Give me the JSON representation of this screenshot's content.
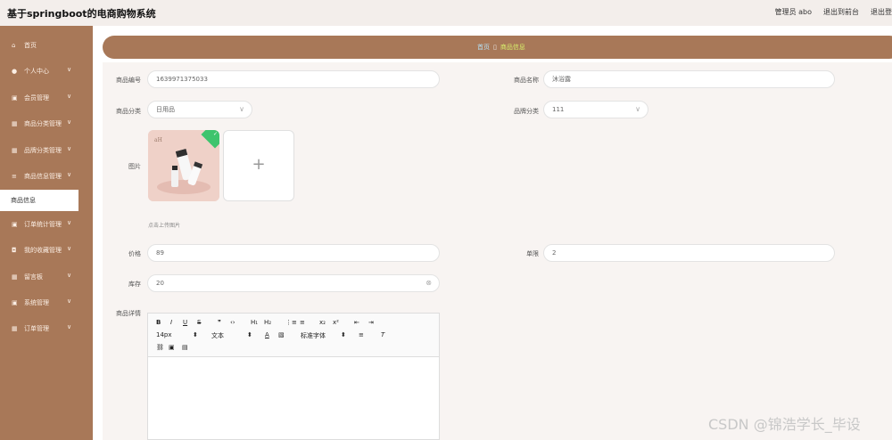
{
  "app": {
    "title": "基于springboot的电商购物系统"
  },
  "header": {
    "user": "管理员 abo",
    "back_front": "退出到前台",
    "logout": "退出登"
  },
  "sidebar": {
    "items": [
      {
        "label": "首页",
        "icon": "home-icon",
        "has_chevron": false
      },
      {
        "label": "个人中心",
        "icon": "person-icon",
        "has_chevron": true
      },
      {
        "label": "会员管理",
        "icon": "briefcase-icon",
        "has_chevron": true
      },
      {
        "label": "商品分类管理",
        "icon": "grid-icon",
        "has_chevron": true
      },
      {
        "label": "品牌分类管理",
        "icon": "grid-icon",
        "has_chevron": true
      },
      {
        "label": "商品信息管理",
        "icon": "list-icon",
        "has_chevron": true
      },
      {
        "label": "商品信息",
        "icon": "",
        "has_chevron": false,
        "active": true
      },
      {
        "label": "订单统计管理",
        "icon": "briefcase-icon",
        "has_chevron": true
      },
      {
        "label": "我的收藏管理",
        "icon": "database-icon",
        "has_chevron": true
      },
      {
        "label": "留言板",
        "icon": "grid-icon",
        "has_chevron": true
      },
      {
        "label": "系统管理",
        "icon": "briefcase-icon",
        "has_chevron": true
      },
      {
        "label": "订单管理",
        "icon": "grid-icon",
        "has_chevron": true
      }
    ]
  },
  "breadcrumb": {
    "home": "首页",
    "sep": "▯",
    "current": "商品信息"
  },
  "form": {
    "code_label": "商品编号",
    "code_value": "1639971375033",
    "name_label": "商品名称",
    "name_value": "沐浴露",
    "category_label": "商品分类",
    "category_value": "日用品",
    "brand_label": "品牌分类",
    "brand_value": "111",
    "image_label": "图片",
    "upload_hint": "点击上传图片",
    "price_label": "价格",
    "price_value": "89",
    "limit_label": "单限",
    "limit_value": "2",
    "stock_label": "库存",
    "stock_value": "20",
    "detail_label": "商品详情"
  },
  "editor": {
    "row1": [
      "B",
      "I",
      "U",
      "S",
      "❞",
      "‹›",
      "H₁",
      "H₂",
      "⋮≡",
      "≡",
      "x₂",
      "x²",
      "⇤",
      "⇥"
    ],
    "font_size": "14px",
    "format": "文本",
    "font_family": "标准字体"
  },
  "watermark": "CSDN @锦浩学长_毕设",
  "colors": {
    "sidebar": "#a87858",
    "breadcrumb_bar": "#a87858",
    "check_badge": "#3ec46d"
  }
}
